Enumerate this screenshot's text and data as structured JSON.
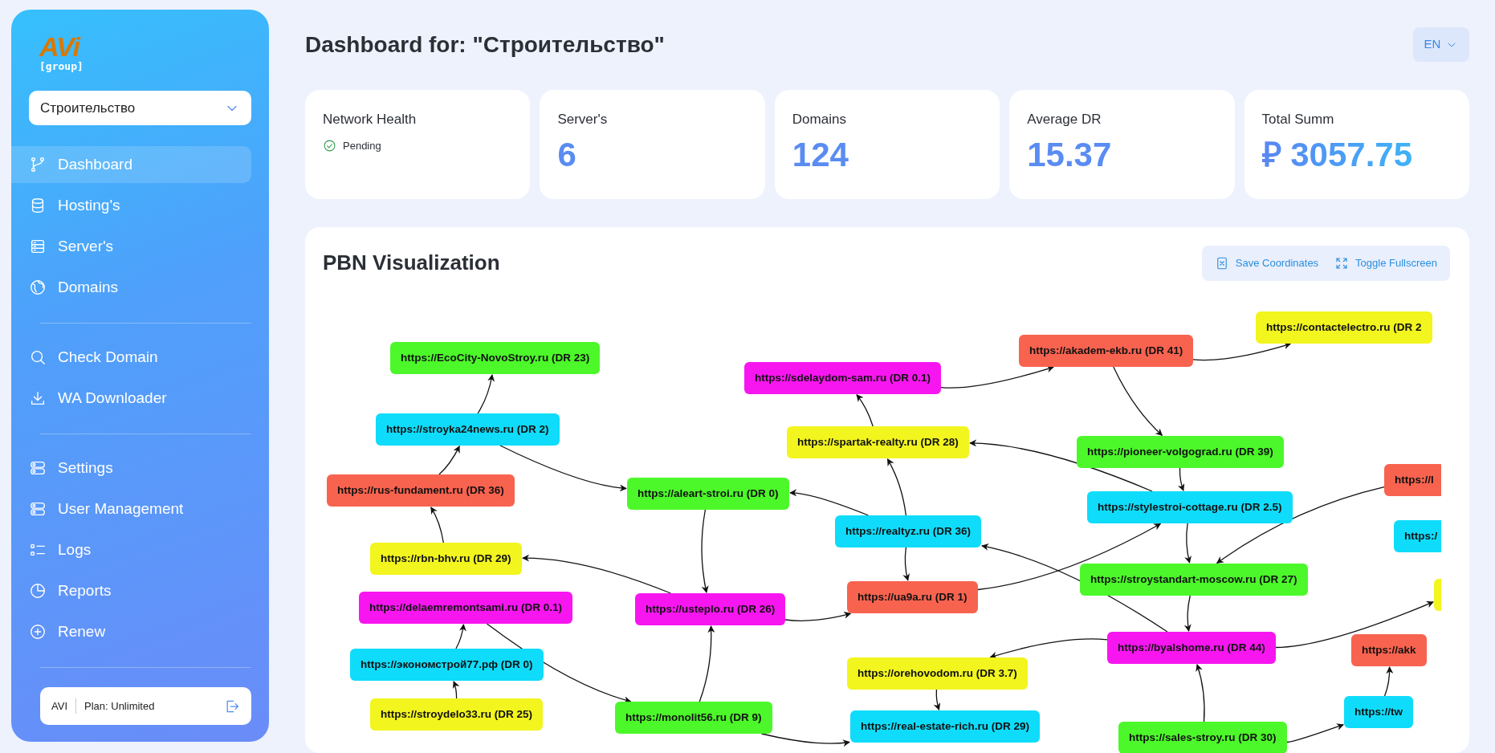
{
  "sidebar": {
    "logo": {
      "name": "AVi",
      "tag": "[group]"
    },
    "project_select": {
      "value": "Строительство"
    },
    "sections": [
      {
        "items": [
          {
            "label": "Dashboard",
            "selected": true
          },
          {
            "label": "Hosting's",
            "selected": false
          },
          {
            "label": "Server's",
            "selected": false
          },
          {
            "label": "Domains",
            "selected": false
          }
        ]
      },
      {
        "items": [
          {
            "label": "Check Domain",
            "selected": false
          },
          {
            "label": "WA Downloader",
            "selected": false
          }
        ]
      },
      {
        "items": [
          {
            "label": "Settings",
            "selected": false
          },
          {
            "label": "User Management",
            "selected": false
          },
          {
            "label": "Logs",
            "selected": false
          },
          {
            "label": "Reports",
            "selected": false
          },
          {
            "label": "Renew",
            "selected": false
          }
        ]
      }
    ],
    "account": {
      "user": "AVI",
      "plan": "Plan: Unlimited"
    }
  },
  "header": {
    "title": "Dashboard for: \"Строительство\"",
    "language": "EN"
  },
  "stats": [
    {
      "kind": "status",
      "label": "Network Health",
      "status": "Pending"
    },
    {
      "kind": "number",
      "label": "Server's",
      "value": "6"
    },
    {
      "kind": "number",
      "label": "Domains",
      "value": "124"
    },
    {
      "kind": "number",
      "label": "Average DR",
      "value": "15.37"
    },
    {
      "kind": "number",
      "label": "Total Summ",
      "value": "₽ 3057.75"
    }
  ],
  "pbn": {
    "title": "PBN Visualization",
    "buttons": [
      "Save Coordinates",
      "Toggle Fullscreen"
    ],
    "graph": {
      "nodes": [
        {
          "label": "https://EcoCity-NovoStroy.ru (DR 23)",
          "color": "#4cf82a"
        },
        {
          "label": "https://stroyka24news.ru (DR 2)",
          "color": "#0fdcfa"
        },
        {
          "label": "https://rus-fundament.ru (DR 36)",
          "color": "#f8634f"
        },
        {
          "label": "https://rbn-bhv.ru (DR 29)",
          "color": "#f2f51e"
        },
        {
          "label": "https://delaemremontsami.ru (DR 0.1)",
          "color": "#f716f0"
        },
        {
          "label": "https://экономстрой77.рф (DR 0)",
          "color": "#0fdcfa"
        },
        {
          "label": "https://stroydelo33.ru (DR 25)",
          "color": "#f2f51e"
        },
        {
          "label": "https://aleart-stroi.ru (DR 0)",
          "color": "#4cf82a"
        },
        {
          "label": "https://usteplo.ru (DR 26)",
          "color": "#f716f0"
        },
        {
          "label": "https://monolit56.ru (DR 9)",
          "color": "#4cf82a"
        },
        {
          "label": "https://sdelaydom-sam.ru (DR 0.1)",
          "color": "#f716f0"
        },
        {
          "label": "https://spartak-realty.ru (DR 28)",
          "color": "#f2f51e"
        },
        {
          "label": "https://realtyz.ru (DR 36)",
          "color": "#0fdcfa"
        },
        {
          "label": "https://ua9a.ru (DR 1)",
          "color": "#f8634f"
        },
        {
          "label": "https://orehovodom.ru (DR 3.7)",
          "color": "#f2f51e"
        },
        {
          "label": "https://real-estate-rich.ru (DR 29)",
          "color": "#0fdcfa"
        },
        {
          "label": "https://akadem-ekb.ru (DR 41)",
          "color": "#f8634f"
        },
        {
          "label": "https://contactelectro.ru (DR 2",
          "color": "#f2f51e"
        },
        {
          "label": "https://pioneer-volgograd.ru (DR 39)",
          "color": "#4cf82a"
        },
        {
          "label": "https://stylestroi-cottage.ru (DR 2.5)",
          "color": "#0fdcfa"
        },
        {
          "label": "https://stroystandart-moscow.ru (DR 27)",
          "color": "#4cf82a"
        },
        {
          "label": "https://byalshome.ru (DR 44)",
          "color": "#f716f0"
        },
        {
          "label": "https://sales-stroy.ru (DR 30)",
          "color": "#4cf82a"
        },
        {
          "label": "https://l",
          "color": "#f8634f"
        },
        {
          "label": "https:/",
          "color": "#0fdcfa"
        },
        {
          "color": "#f2f51e"
        },
        {
          "label": "https://akk",
          "color": "#f8634f"
        },
        {
          "label": "https://tw",
          "color": "#0fdcfa"
        }
      ]
    }
  }
}
